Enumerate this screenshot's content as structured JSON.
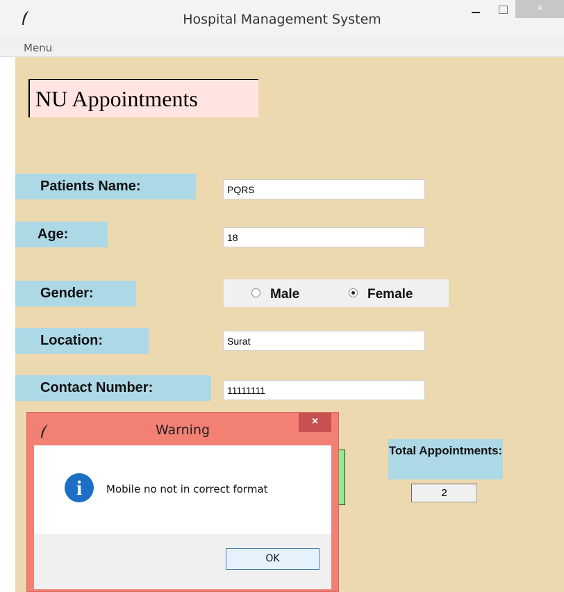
{
  "window": {
    "title": "Hospital Management System",
    "app_icon": "feather-icon",
    "controls": {
      "minimize_icon": "minimize-icon",
      "maximize_icon": "maximize-icon",
      "close_label": "×"
    }
  },
  "menubar": {
    "items": [
      {
        "label": "Menu"
      }
    ]
  },
  "form": {
    "heading": "NU Appointments",
    "fields": {
      "name": {
        "label": "Patients Name:",
        "value": "PQRS"
      },
      "age": {
        "label": "Age:",
        "value": "18"
      },
      "gender": {
        "label": "Gender:",
        "options": [
          {
            "label": "Male",
            "selected": false
          },
          {
            "label": "Female",
            "selected": true
          }
        ]
      },
      "location": {
        "label": "Location:",
        "value": "Surat"
      },
      "contact": {
        "label": "Contact Number:",
        "value": "11111111"
      }
    },
    "total": {
      "label": "Total Appointments:",
      "value": "2"
    }
  },
  "dialog": {
    "title": "Warning",
    "close_label": "×",
    "icon": "info-icon",
    "icon_glyph": "i",
    "message": "Mobile no not in correct format",
    "ok_label": "OK"
  },
  "colors": {
    "background": "#ecd9b0",
    "label_bg": "#add8e6",
    "heading_bg": "#ffe4e1",
    "dialog_frame": "#f28073",
    "button_green": "#90ee90",
    "info_blue": "#1c6fc4"
  }
}
